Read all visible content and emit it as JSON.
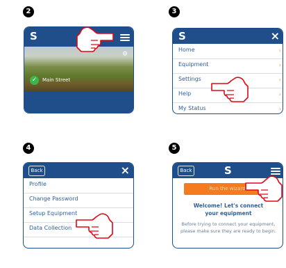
{
  "steps": [
    "2",
    "3",
    "4",
    "5"
  ],
  "panel2": {
    "logo": "S",
    "location": "Main Street"
  },
  "panel3": {
    "logo": "S",
    "close": "×",
    "menu": [
      "Home",
      "Equipment",
      "Settings",
      "Help",
      "My Status"
    ]
  },
  "panel4": {
    "back": "Back",
    "close": "×",
    "menu": [
      "Profile",
      "Change Password",
      "Setup Equipment",
      "Data Collection"
    ]
  },
  "panel5": {
    "back": "Back",
    "logo": "S",
    "orange_button": "Run the wizard",
    "welcome": "Welcome! Let's connect your equipment",
    "body": "Before trying to connect your equipment, please make sure they are ready to begin."
  },
  "colors": {
    "brand_blue": "#1f4e8a",
    "accent_orange": "#f47b20",
    "badge_green": "#3cb54a"
  }
}
